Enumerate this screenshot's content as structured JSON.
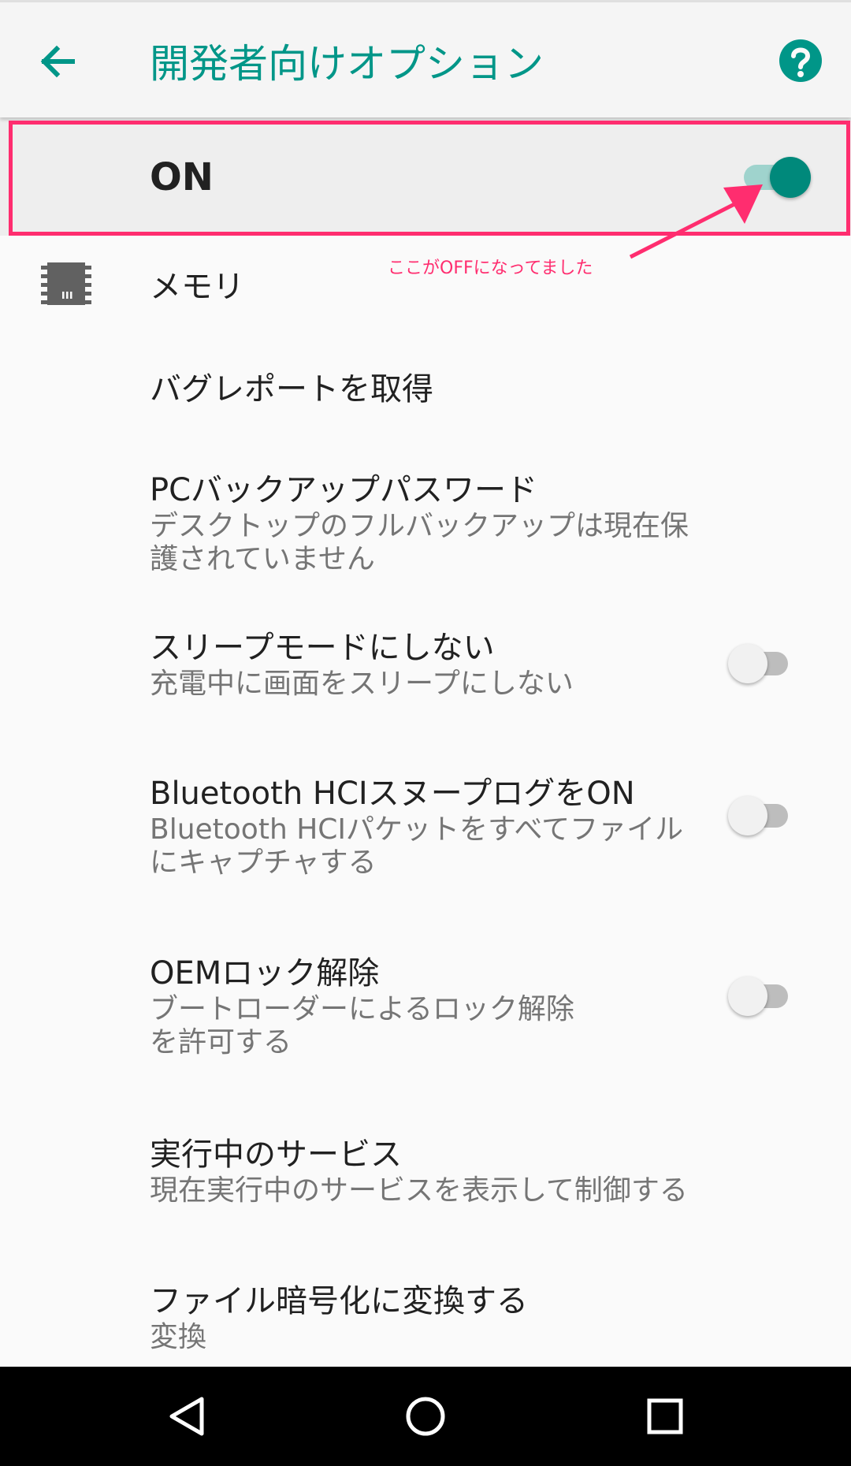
{
  "app_bar": {
    "title": "開発者向けオプション",
    "back_icon": "arrow-back-icon",
    "help_icon": "help-icon"
  },
  "master_switch": {
    "label": "ON",
    "state": "on"
  },
  "annotation": {
    "text": "ここがOFFになってました",
    "color": "#ff2d6f"
  },
  "settings": [
    {
      "title": "メモリ",
      "icon": "memory-chip-icon"
    },
    {
      "title": "バグレポートを取得"
    },
    {
      "title": "PCバックアップパスワード",
      "summary_lines": [
        "デスクトップのフルバックアップは現在保",
        "護されていません"
      ]
    },
    {
      "title": "スリープモードにしない",
      "summary_lines": [
        "充電中に画面をスリープにしない"
      ],
      "toggle": "off"
    },
    {
      "title": "Bluetooth HCIスヌープログをON",
      "summary_lines": [
        "Bluetooth HCIパケットをすべてファイル",
        "にキャプチャする"
      ],
      "toggle": "off"
    },
    {
      "title": "OEMロック解除",
      "summary_lines": [
        "ブートローダーによるロック解除",
        "を許可する"
      ],
      "toggle": "off"
    },
    {
      "title": "実行中のサービス",
      "summary_lines": [
        "現在実行中のサービスを表示して制御する"
      ]
    },
    {
      "title": "ファイル暗号化に変換する",
      "summary_lines": [
        "変換"
      ]
    }
  ],
  "nav_bar": {
    "back_icon": "nav-back-triangle-icon",
    "home_icon": "nav-home-circle-icon",
    "recents_icon": "nav-recents-square-icon"
  },
  "colors": {
    "accent": "#009688",
    "switch_on_thumb": "#00897b",
    "switch_on_track": "#9fd3cd",
    "annotation": "#ff2d6f"
  }
}
